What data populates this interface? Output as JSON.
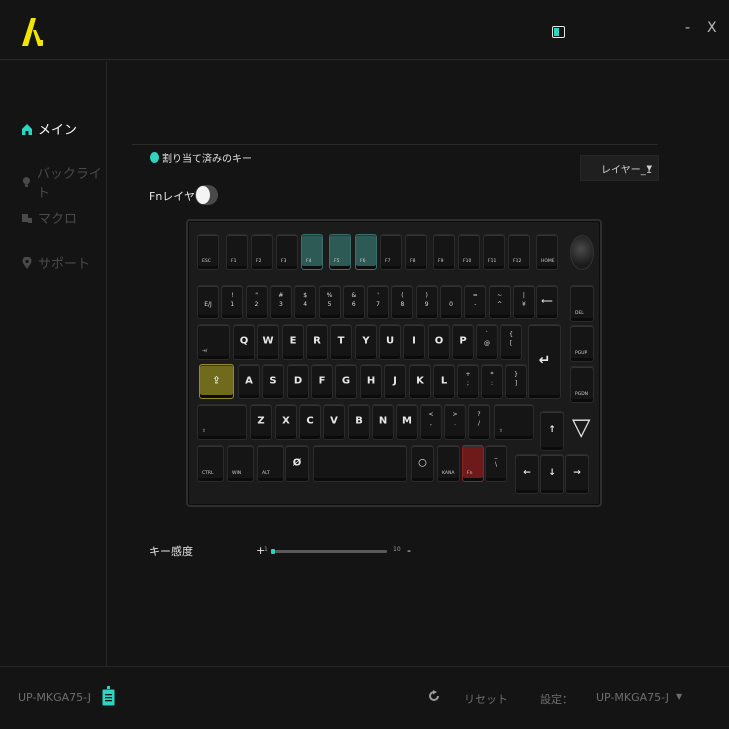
{
  "window": {
    "minimize": "-",
    "close": "X"
  },
  "sidebar": {
    "items": [
      {
        "label": "メイン",
        "active": true
      },
      {
        "label": "バックライト",
        "active": false
      },
      {
        "label": "マクロ",
        "active": false
      },
      {
        "label": "サポート",
        "active": false
      }
    ]
  },
  "legend": {
    "assigned_label": "割り当て済みのキー"
  },
  "layer": {
    "selected": "レイヤー_1"
  },
  "fn": {
    "label": "Fnレイヤー",
    "on": false
  },
  "sensitivity": {
    "label": "キー感度",
    "plus": "+",
    "min": "1",
    "max": "10",
    "minus": "-",
    "value": 1
  },
  "footer": {
    "device": "UP-MKGA75-J",
    "reset": "リセット",
    "settings_label": "設定：",
    "settings_value": "UP-MKGA75-J"
  },
  "keyboard": {
    "row0": [
      "ESC",
      "F1",
      "F2",
      "F3",
      "F4",
      "F5",
      "F6",
      "F7",
      "F8",
      "F9",
      "F10",
      "F11",
      "F12",
      "HOME"
    ],
    "row1": [
      {
        "top": "",
        "bottom": "E/J"
      },
      {
        "top": "!",
        "bottom": "1"
      },
      {
        "top": "\"",
        "bottom": "2"
      },
      {
        "top": "#",
        "bottom": "3"
      },
      {
        "top": "$",
        "bottom": "4"
      },
      {
        "top": "%",
        "bottom": "5"
      },
      {
        "top": "&",
        "bottom": "6"
      },
      {
        "top": "'",
        "bottom": "7"
      },
      {
        "top": "(",
        "bottom": "8"
      },
      {
        "top": ")",
        "bottom": "9"
      },
      {
        "top": "",
        "bottom": "0"
      },
      {
        "top": "=",
        "bottom": "-"
      },
      {
        "top": "~",
        "bottom": "^"
      },
      {
        "top": "|",
        "bottom": "¥"
      }
    ],
    "backspace": "⟵",
    "del": "DEL",
    "tab": "⇥/",
    "row2": [
      "Q",
      "W",
      "E",
      "R",
      "T",
      "Y",
      "U",
      "I",
      "O",
      "P"
    ],
    "row2_sym": [
      {
        "top": "`",
        "bottom": "@"
      },
      {
        "top": "{",
        "bottom": "["
      }
    ],
    "enter": "↵",
    "pgup": "PGUP",
    "caps": "⇪",
    "row3": [
      "A",
      "S",
      "D",
      "F",
      "G",
      "H",
      "J",
      "K",
      "L"
    ],
    "row3_sym": [
      {
        "top": "+",
        "bottom": ";"
      },
      {
        "top": "*",
        "bottom": ":"
      },
      {
        "top": "}",
        "bottom": "]"
      }
    ],
    "pgdn": "PGDN",
    "lshift": "⇧",
    "row4": [
      "Z",
      "X",
      "C",
      "V",
      "B",
      "N",
      "M"
    ],
    "row4_sym": [
      {
        "top": "<",
        "bottom": ","
      },
      {
        "top": ">",
        "bottom": "."
      },
      {
        "top": "?",
        "bottom": "/"
      }
    ],
    "rshift": "⇧",
    "brand_mark": "▽",
    "up": "↑",
    "ctrl": "CTRL",
    "win": "WIN",
    "alt": "ALT",
    "muhenkan": "Ø",
    "henkan": "○",
    "kana": "KANA",
    "fn_key": "Fn",
    "ro": {
      "top": "_",
      "bottom": "\\"
    },
    "left": "←",
    "down": "↓",
    "right": "→"
  },
  "colors": {
    "accent": "#2dd4bf",
    "teal_key": "#2e5a55",
    "olive_key": "#6f6a1c",
    "red_key": "#6e1a1a",
    "logo": "#f2e600"
  }
}
